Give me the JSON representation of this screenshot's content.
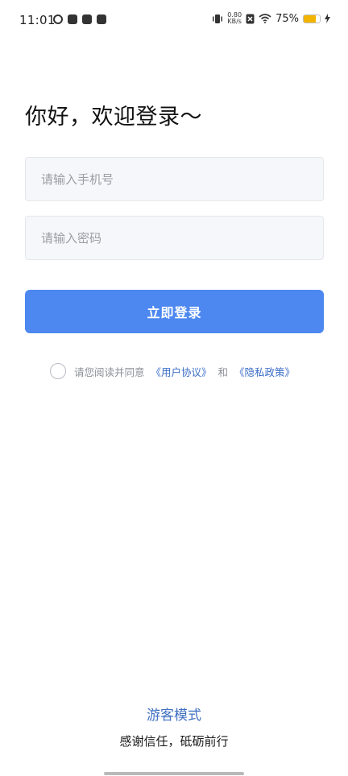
{
  "status_bar": {
    "time": "11:01",
    "net_speed_value": "0.80",
    "net_speed_unit": "KB/s",
    "battery_percent": "75%",
    "battery_level": 0.75,
    "battery_color": "#f2b400"
  },
  "login": {
    "welcome_text": "你好，欢迎登录～",
    "phone_placeholder": "请输入手机号",
    "phone_value": "",
    "password_placeholder": "请输入密码",
    "password_value": "",
    "login_button_label": "立即登录",
    "accent_color": "#4d88f0"
  },
  "agreement": {
    "prefix": "请您阅读并同意",
    "user_agreement": "《用户协议》",
    "conjunction": "和",
    "privacy_policy": "《隐私政策》",
    "checked": false
  },
  "footer": {
    "guest_mode": "游客模式",
    "slogan": "感谢信任，砥砺前行"
  }
}
